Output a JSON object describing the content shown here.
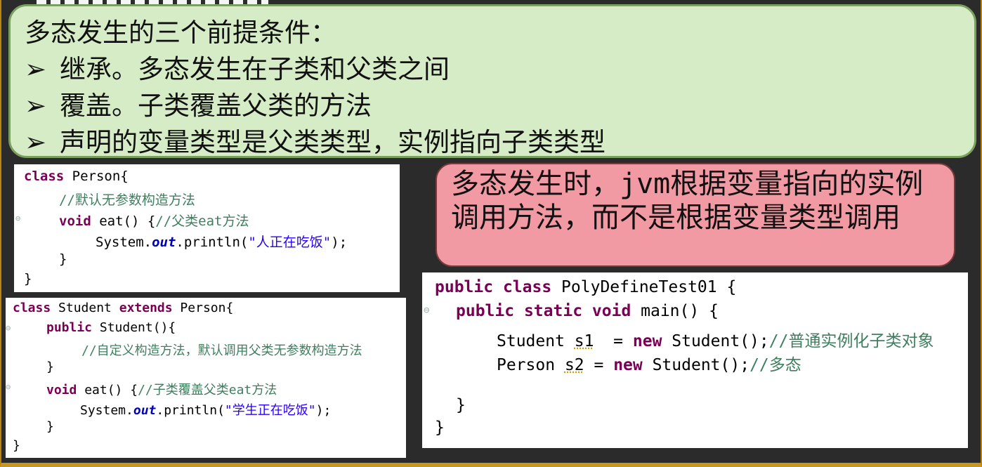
{
  "conditions": {
    "title": "多态发生的三个前提条件：",
    "bullet_symbol": "➢",
    "items": [
      "继承。多态发生在子类和父类之间",
      "覆盖。子类覆盖父类的方法",
      "声明的变量类型是父类类型，实例指向子类类型"
    ]
  },
  "note": {
    "text": "多态发生时，jvm根据变量指向的实例调用方法，而不是根据变量类型调用"
  },
  "person_code": {
    "class_kw": "class",
    "class_name": " Person{",
    "comment1": "//默认无参数构造方法",
    "void_kw": "void",
    "eat_sig": " eat() {",
    "eat_comment": "//父类eat方法",
    "sysout_prefix": "System.",
    "out_field": "out",
    "println_open": ".println(",
    "string": "\"人正在吃饭\"",
    "println_close": ");",
    "close_method": "}",
    "close_class": "}"
  },
  "student_code": {
    "class_kw": "class",
    "class_name": " Student ",
    "extends_kw": "extends",
    "parent": " Person{",
    "public_kw": "public",
    "ctor_sig": " Student(){",
    "ctor_comment": "//自定义构造方法，默认调用父类无参数构造方法",
    "close_ctor": "}",
    "void_kw": "void",
    "eat_sig": " eat() {",
    "eat_comment": "//子类覆盖父类eat方法",
    "sysout_prefix": "System.",
    "out_field": "out",
    "println_open": ".println(",
    "string": "\"学生正在吃饭\"",
    "println_close": ");",
    "close_method": "}",
    "close_class": "}"
  },
  "main_code": {
    "public_kw": "public",
    "class_kw": "class",
    "class_name": " PolyDefineTest01 {",
    "static_kw": "static",
    "void_kw": "void",
    "main_sig": " main() {",
    "line1_type": "Student ",
    "line1_var": "s1",
    "line1_eq": "  = ",
    "new_kw": "new",
    "line1_ctor": " Student();",
    "line1_comment": "//普通实例化子类对象",
    "line2_type": "Person ",
    "line2_var": "s2",
    "line2_eq": " = ",
    "line2_ctor": " Student();",
    "line2_comment": "//多态",
    "close_method": "}",
    "close_class": "}"
  },
  "icons": {
    "fold_marker": "minus-circle-icon"
  }
}
